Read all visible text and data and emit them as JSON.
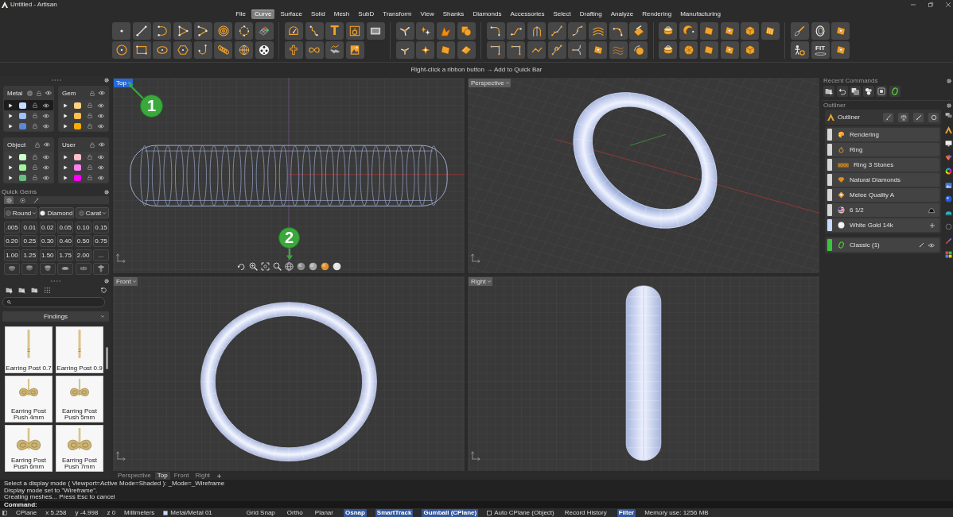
{
  "window": {
    "title": "Untitled - Artisan"
  },
  "menu_tabs": [
    {
      "label": "File",
      "selected": false
    },
    {
      "label": "Curve",
      "selected": true
    },
    {
      "label": "Surface",
      "selected": false
    },
    {
      "label": "Solid",
      "selected": false
    },
    {
      "label": "Mesh",
      "selected": false
    },
    {
      "label": "SubD",
      "selected": false
    },
    {
      "label": "Transform",
      "selected": false
    },
    {
      "label": "View",
      "selected": false
    },
    {
      "label": "Shanks",
      "selected": false
    },
    {
      "label": "Diamonds",
      "selected": false
    },
    {
      "label": "Accessories",
      "selected": false
    },
    {
      "label": "Select",
      "selected": false
    },
    {
      "label": "Drafting",
      "selected": false
    },
    {
      "label": "Analyze",
      "selected": false
    },
    {
      "label": "Rendering",
      "selected": false
    },
    {
      "label": "Manufacturing",
      "selected": false
    }
  ],
  "ribbon": {
    "text_tool": "T",
    "fit_tool": "FIT",
    "hint": "Right-click a ribbon button → Add to Quick Bar"
  },
  "layers": [
    {
      "name": "Metal",
      "kind": "metal",
      "rows": [
        {
          "color": "#c8dcff",
          "selected": true
        },
        {
          "color": "#9ec2ff",
          "selected": false
        },
        {
          "color": "#5a88d8",
          "selected": false
        }
      ]
    },
    {
      "name": "Gem",
      "kind": "basic",
      "rows": [
        {
          "color": "#ffd27f",
          "selected": false
        },
        {
          "color": "#ffc04c",
          "selected": false
        },
        {
          "color": "#ffaa00",
          "selected": false
        }
      ]
    },
    {
      "name": "Object",
      "kind": "basic",
      "rows": [
        {
          "color": "#ccffcc",
          "selected": false
        },
        {
          "color": "#a0f5a0",
          "selected": false
        },
        {
          "color": "#66c080",
          "selected": false
        }
      ]
    },
    {
      "name": "User",
      "kind": "basic",
      "rows": [
        {
          "color": "#ffc0cc",
          "selected": false
        },
        {
          "color": "#ff80f0",
          "selected": false
        },
        {
          "color": "#ff00ff",
          "selected": false
        }
      ]
    }
  ],
  "quick_gems": {
    "title": "Quick Gems",
    "tabs": [
      {
        "selected": true
      },
      {
        "selected": false
      },
      {
        "selected": false
      }
    ],
    "shape": "Round",
    "cut": "Diamond",
    "unit": "Carat",
    "sizes": [
      ".005",
      "0.01",
      "0.02",
      "0.05",
      "0.10",
      "0.15",
      "0.20",
      "0.25",
      "0.30",
      "0.40",
      "0.50",
      "0.75",
      "1.00",
      "1.25",
      "1.50",
      "1.75",
      "2.00",
      "..."
    ]
  },
  "library": {
    "category": "Findings",
    "items": [
      {
        "caption": "Earring Post 0.7",
        "kind": "post"
      },
      {
        "caption": "Earring Post 0.9",
        "kind": "post"
      },
      {
        "caption": "Earring Post Push 4mm",
        "kind": "push"
      },
      {
        "caption": "Earring Post Push 5mm",
        "kind": "push"
      },
      {
        "caption": "Earring Post Push 6mm",
        "kind": "push-large"
      },
      {
        "caption": "Earring Post Push 7mm",
        "kind": "push-large"
      }
    ]
  },
  "viewports": [
    {
      "label": "Top",
      "selected": true,
      "kind": "top",
      "callouts": [
        {
          "number": "1"
        },
        {
          "number": "2"
        }
      ]
    },
    {
      "label": "Perspective",
      "selected": false,
      "kind": "perspective"
    },
    {
      "label": "Front",
      "selected": false,
      "kind": "front"
    },
    {
      "label": "Right",
      "selected": false,
      "kind": "right"
    }
  ],
  "viewport_tabs": [
    {
      "label": "Perspective",
      "selected": false
    },
    {
      "label": "Top",
      "selected": true
    },
    {
      "label": "Front",
      "selected": false
    },
    {
      "label": "Right",
      "selected": false
    }
  ],
  "recent_commands": {
    "title": "Recent Commands"
  },
  "outliner": {
    "title": "Outliner",
    "header": "Outliner",
    "items": [
      {
        "label": "Rendering",
        "kind": "rendering",
        "color": "#d6d6d6"
      },
      {
        "label": "Ring",
        "kind": "ring",
        "color": "#d6d6d6"
      },
      {
        "label": "Ring 3 Stones",
        "kind": "stones",
        "color": "#d6d6d6"
      },
      {
        "label": "Natural Diamonds",
        "kind": "diamond",
        "color": "#d6d6d6"
      },
      {
        "label": "Melee Quality A",
        "kind": "quality",
        "color": "#d6d6d6"
      },
      {
        "label": "6 1/2",
        "kind": "size",
        "color": "#d6d6d6"
      },
      {
        "label": "White Gold 14k",
        "kind": "metal",
        "color": "#c8dcff"
      }
    ],
    "model": {
      "label": "Classic (1)",
      "color": "#3cc43c"
    }
  },
  "command_history": [
    "Select a display mode ( Viewport=Active Mode=Shaded ): _Mode=_Wireframe",
    "Display mode set to \"Wireframe\".",
    "Creating meshes... Press Esc to cancel"
  ],
  "command_prompt": "Command:",
  "status_bar": {
    "cplane": "CPlane",
    "x": "x 5.258",
    "y": "y -4.998",
    "z": "z 0",
    "units": "Millimeters",
    "layer": "Metal/Metal 01",
    "toggles": [
      {
        "label": "Grid Snap",
        "on": false,
        "kind": "toggle"
      },
      {
        "label": "Ortho",
        "on": false,
        "kind": "toggle"
      },
      {
        "label": "Planar",
        "on": false,
        "kind": "toggle"
      },
      {
        "label": "Osnap",
        "on": true,
        "kind": "toggle"
      },
      {
        "label": "SmartTrack",
        "on": true,
        "kind": "toggle"
      },
      {
        "label": "Gumball (CPlane)",
        "on": true,
        "kind": "toggle"
      },
      {
        "label": "Auto CPlane (Object)",
        "on": false,
        "kind": "checkbox"
      },
      {
        "label": "Record History",
        "on": false,
        "kind": "toggle"
      },
      {
        "label": "Filter",
        "on": true,
        "kind": "toggle"
      }
    ],
    "memory": "Memory use: 1256 MB"
  }
}
